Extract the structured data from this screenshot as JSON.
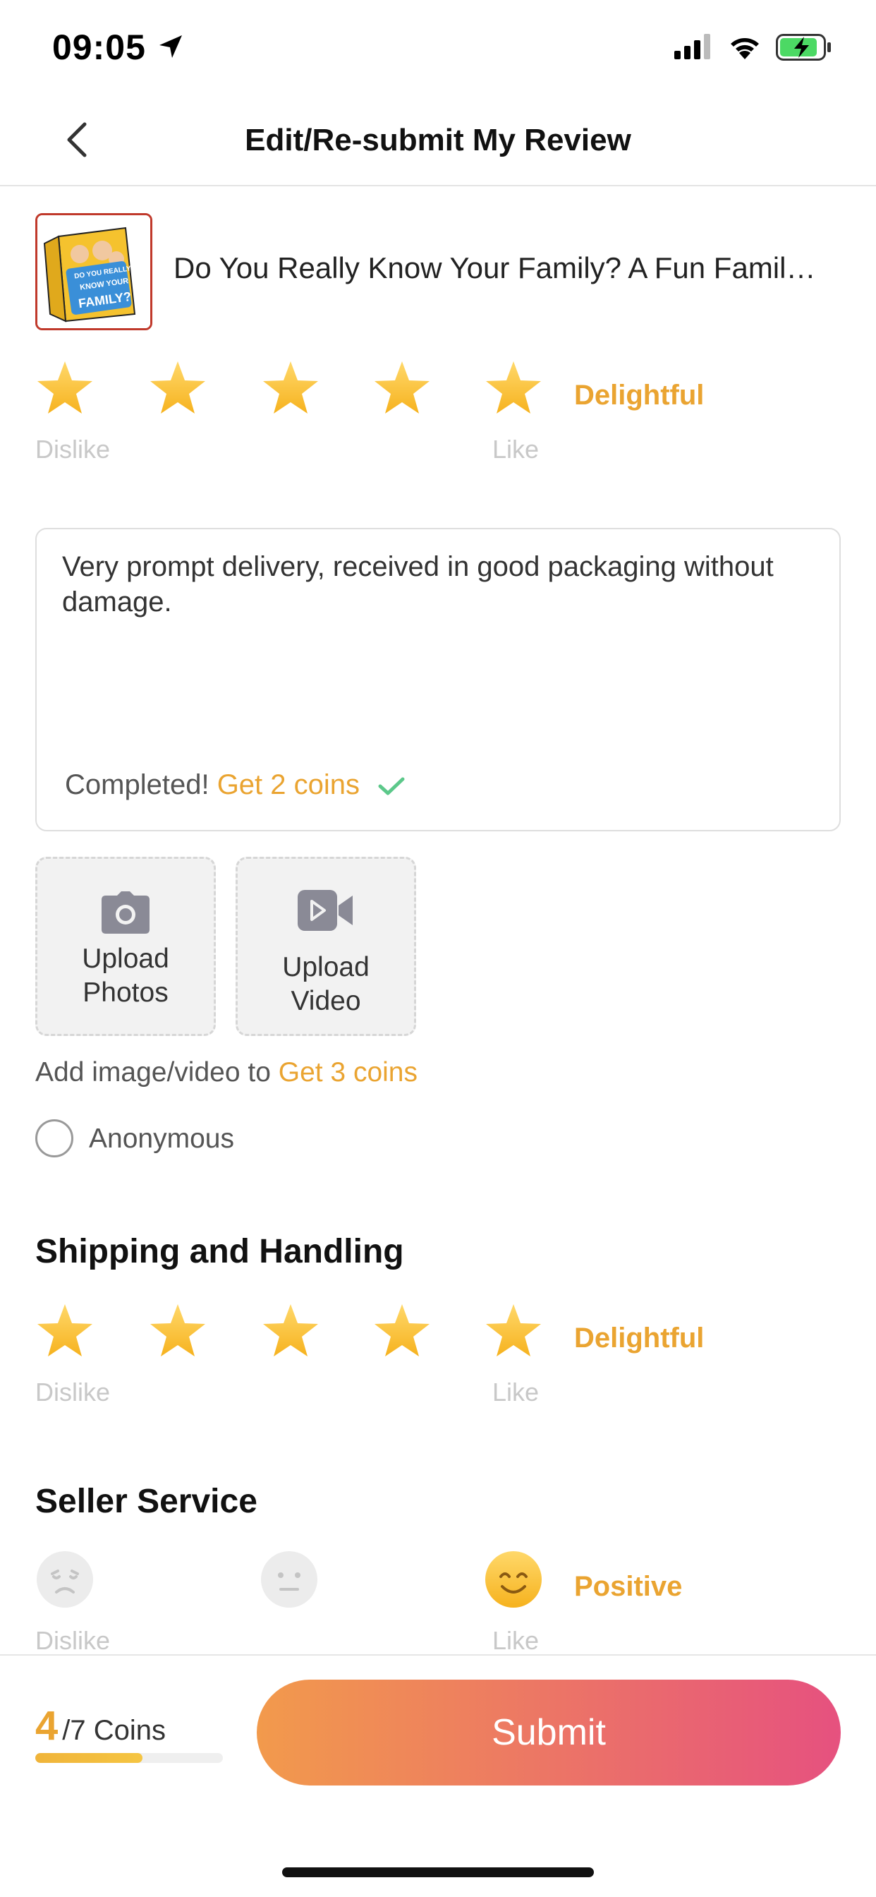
{
  "status_bar": {
    "time": "09:05"
  },
  "nav": {
    "title": "Edit/Re-submit My Review",
    "back_icon": "chevron-left-icon"
  },
  "product": {
    "name": "Do You Really Know Your Family? A Fun Famil…",
    "thumbnail_text": [
      "DO YOU REALLY",
      "KNOW YOUR",
      "FAMILY?"
    ]
  },
  "product_rating": {
    "stars": 5,
    "max": 5,
    "word": "Delightful",
    "hint_left": "Dislike",
    "hint_right": "Like"
  },
  "review": {
    "text": "Very prompt delivery, received in good packaging without damage.",
    "status_prefix": "Completed!",
    "status_coins": "Get 2 coins"
  },
  "upload": {
    "photos_line1": "Upload",
    "photos_line2": "Photos",
    "video_line1": "Upload",
    "video_line2": "Video"
  },
  "media_hint": {
    "prefix": "Add image/video to",
    "coins": "Get 3 coins"
  },
  "anonymous": {
    "label": "Anonymous",
    "checked": false
  },
  "shipping": {
    "title": "Shipping and Handling",
    "stars": 5,
    "max": 5,
    "word": "Delightful",
    "hint_left": "Dislike",
    "hint_right": "Like"
  },
  "seller": {
    "title": "Seller Service",
    "options": [
      "negative-face-icon",
      "neutral-face-icon",
      "positive-face-icon"
    ],
    "selected": "positive",
    "word": "Positive",
    "hint_left": "Dislike",
    "hint_right": "Like"
  },
  "footer": {
    "coins_earned": "4",
    "coins_total": "/7 Coins",
    "progress_fraction": 0.57,
    "submit_label": "Submit"
  },
  "colors": {
    "accent": "#eaa431",
    "submit_gradient_start": "#f29a4c",
    "submit_gradient_end": "#e6517f"
  }
}
